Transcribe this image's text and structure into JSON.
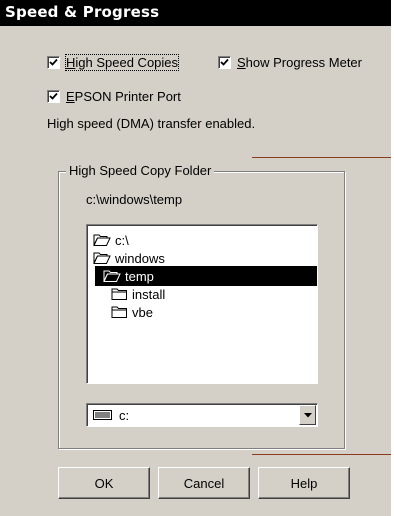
{
  "title": "Speed & Progress",
  "options": {
    "high_speed_copies": {
      "label": "High Speed Copies",
      "checked": true
    },
    "show_progress_meter": {
      "label": "Show Progress Meter",
      "checked": true
    },
    "epson_printer_port": {
      "label": "EPSON Printer Port",
      "checked": true
    }
  },
  "info_text": "High speed (DMA) transfer enabled.",
  "folder_group": {
    "legend": "High Speed Copy Folder",
    "current_path": "c:\\windows\\temp",
    "tree": [
      {
        "label": "c:\\",
        "icon": "open-folder-icon"
      },
      {
        "label": "windows",
        "icon": "open-folder-icon"
      },
      {
        "label": "temp",
        "icon": "open-folder-icon",
        "selected": true
      },
      {
        "label": "install",
        "icon": "folder-icon"
      },
      {
        "label": "vbe",
        "icon": "folder-icon"
      }
    ],
    "drive": {
      "value": "c:",
      "icon": "drive-icon"
    }
  },
  "buttons": {
    "ok": "OK",
    "cancel": "Cancel",
    "help": "Help"
  },
  "colors": {
    "titlebar_bg": "#000000",
    "dialog_bg": "#d4d0c8",
    "selection_bg": "#000000",
    "accent_line": "#8b3a1d"
  }
}
